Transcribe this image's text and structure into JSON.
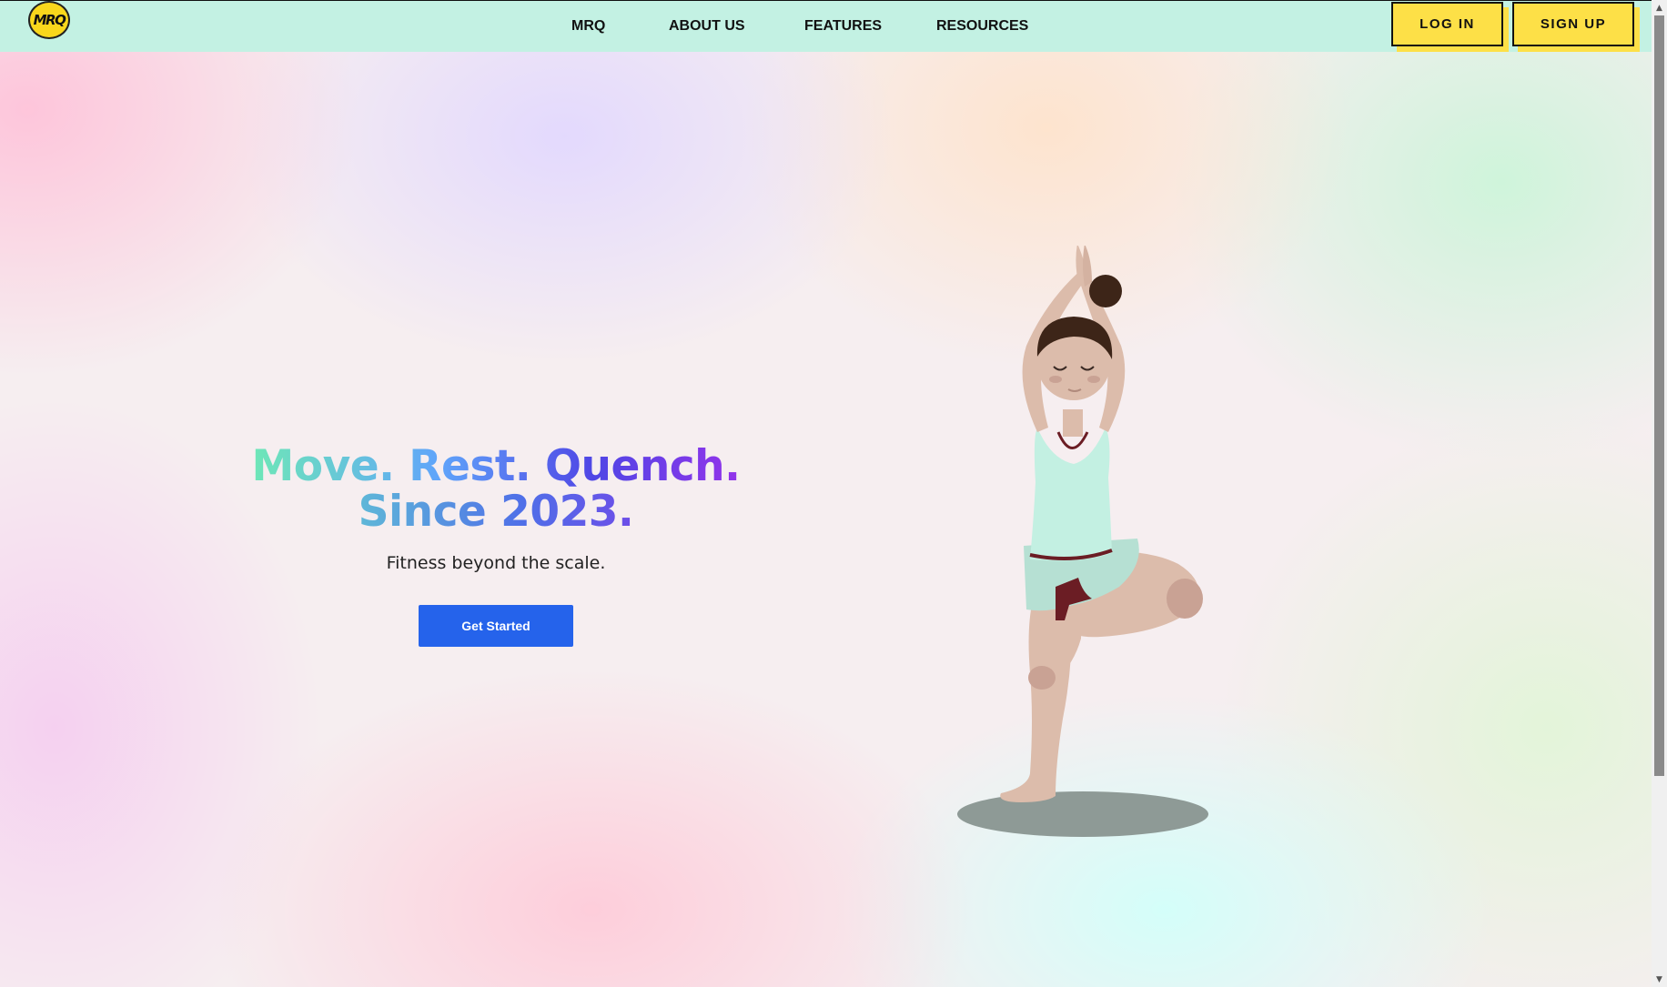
{
  "nav": {
    "logo_text": "MRQ",
    "links": [
      "MRQ",
      "ABOUT US",
      "FEATURES",
      "RESOURCES"
    ],
    "login_label": "LOG IN",
    "signup_label": "SIGN UP"
  },
  "hero": {
    "headline_line1": "Move. Rest. Quench.",
    "headline_line2": "Since 2023.",
    "subheading": "Fitness beyond the scale.",
    "cta_label": "Get Started"
  },
  "colors": {
    "navbar_bg": "#c3f1e3",
    "auth_button_bg": "#fde047",
    "cta_bg": "#2563eb",
    "logo_bg": "#f9d71c"
  },
  "icons": {
    "scroll_up": "▲",
    "scroll_down": "▼"
  }
}
